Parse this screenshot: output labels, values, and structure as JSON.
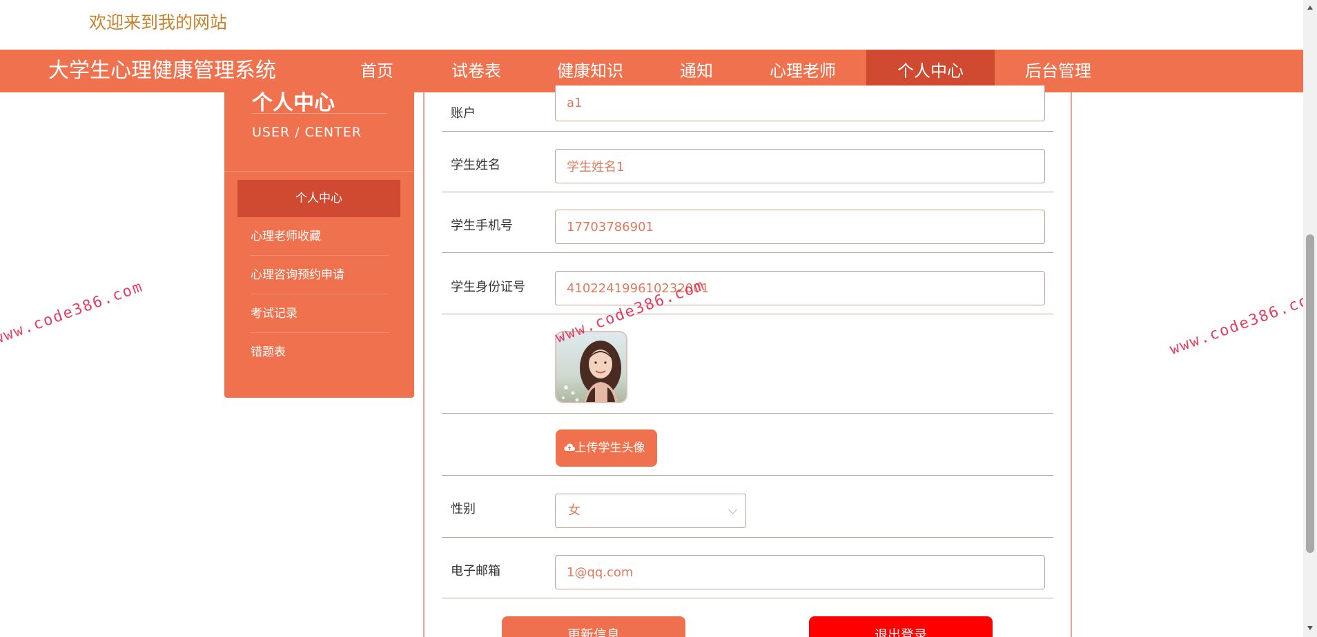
{
  "header": {
    "welcome": "欢迎来到我的网站",
    "brand": "大学生心理健康管理系统",
    "nav": [
      {
        "label": "首页"
      },
      {
        "label": "试卷表"
      },
      {
        "label": "健康知识"
      },
      {
        "label": "通知"
      },
      {
        "label": "心理老师"
      },
      {
        "label": "个人中心",
        "active": true
      },
      {
        "label": "后台管理"
      }
    ]
  },
  "sidebar": {
    "title": "个人中心",
    "subtitle": "USER / CENTER",
    "items": [
      {
        "label": "个人中心",
        "active": true
      },
      {
        "label": "心理老师收藏"
      },
      {
        "label": "心理咨询预约申请"
      },
      {
        "label": "考试记录"
      },
      {
        "label": "错题表"
      }
    ]
  },
  "form": {
    "account": {
      "label": "账户",
      "value": "a1"
    },
    "name": {
      "label": "学生姓名",
      "value": "学生姓名1"
    },
    "phone": {
      "label": "学生手机号",
      "value": "17703786901"
    },
    "id_card": {
      "label": "学生身份证号",
      "value": "410224199610232001"
    },
    "upload_label": "上传学生头像",
    "gender": {
      "label": "性别",
      "value": "女"
    },
    "email": {
      "label": "电子邮箱",
      "value": "1@qq.com"
    },
    "update_label": "更新信息",
    "logout_label": "退出登录"
  },
  "watermark": "www.code386.com",
  "colors": {
    "primary": "#f0714d",
    "primary_dark": "#d04a32",
    "logout": "#ff0000",
    "welcome": "#c9822c"
  }
}
